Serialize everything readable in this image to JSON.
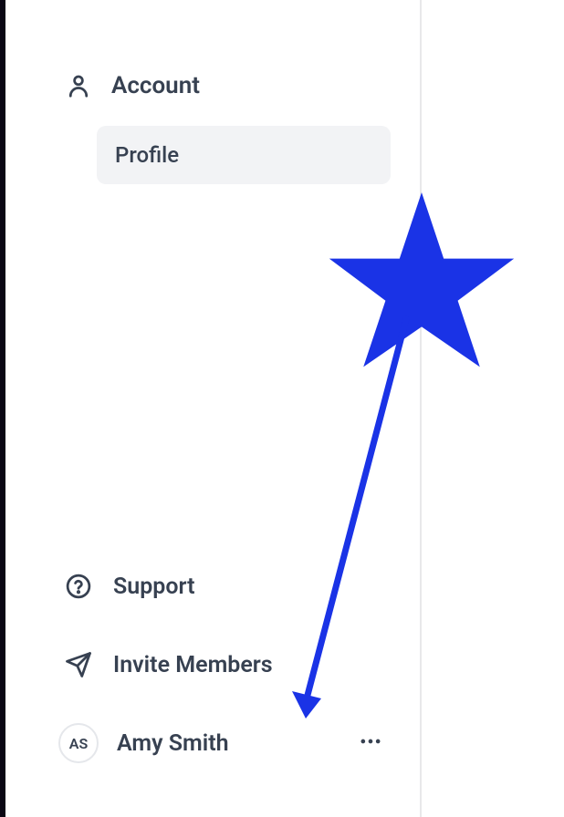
{
  "sidebar": {
    "account": {
      "title": "Account",
      "items": [
        {
          "label": "Profile",
          "active": true
        }
      ]
    },
    "support": {
      "label": "Support"
    },
    "invite": {
      "label": "Invite Members"
    },
    "user": {
      "initials": "AS",
      "name": "Amy Smith"
    }
  },
  "annotation": {
    "color": "#1a33e6"
  }
}
